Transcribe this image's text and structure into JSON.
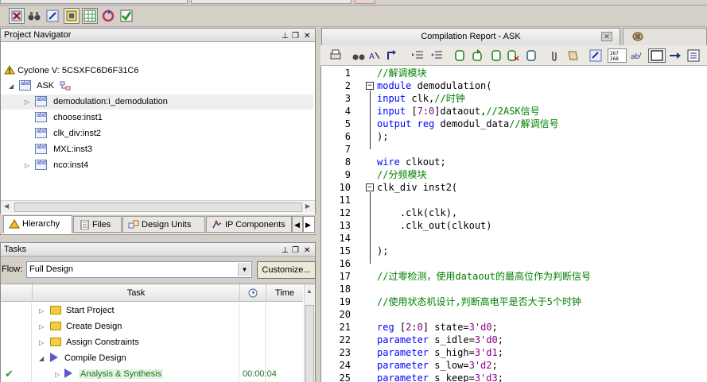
{
  "navigator": {
    "title": "Project Navigator",
    "device": "Cyclone V: 5CSXFC6D6F31C6",
    "top_entity": "ASK",
    "instances": [
      {
        "label": "demodulation:i_demodulation",
        "expandable": true,
        "selected": true
      },
      {
        "label": "choose:inst1",
        "expandable": false
      },
      {
        "label": "clk_div:inst2",
        "expandable": false
      },
      {
        "label": "MXL:inst3",
        "expandable": false
      },
      {
        "label": "nco:inst4",
        "expandable": true
      }
    ],
    "tabs": [
      "Hierarchy",
      "Files",
      "Design Units",
      "IP Components"
    ]
  },
  "tasks": {
    "title": "Tasks",
    "flow_label": "Flow:",
    "flow_value": "Full Design",
    "customize_label": "Customize...",
    "columns": [
      "Task",
      "Time"
    ],
    "rows": [
      {
        "status": "",
        "label": "Start Project",
        "icon": "folder-icon",
        "time": ""
      },
      {
        "status": "",
        "label": "Create Design",
        "icon": "folder-icon",
        "time": ""
      },
      {
        "status": "",
        "label": "Assign Constraints",
        "icon": "folder-icon",
        "time": ""
      },
      {
        "status": "",
        "label": "Compile Design",
        "icon": "play-icon",
        "time": ""
      },
      {
        "status": "✔",
        "label": "Analysis & Synthesis",
        "icon": "play-icon",
        "time": "00:00:04"
      }
    ]
  },
  "editor": {
    "tab_title": "Compilation Report - ASK",
    "lines": [
      {
        "n": "1",
        "code": "//解调模块",
        "fold": ""
      },
      {
        "n": "2",
        "code": "module demodulation(",
        "fold": "minus"
      },
      {
        "n": "3",
        "code": "input clk,//时钟",
        "fold": ""
      },
      {
        "n": "4",
        "code": "input [7:0]dataout,//2ASK信号",
        "fold": ""
      },
      {
        "n": "5",
        "code": "output reg demodul_data//解调信号",
        "fold": ""
      },
      {
        "n": "6",
        "code": ");",
        "fold": ""
      },
      {
        "n": "7",
        "code": "",
        "fold": ""
      },
      {
        "n": "8",
        "code": "wire clkout;",
        "fold": ""
      },
      {
        "n": "9",
        "code": "//分频模块",
        "fold": ""
      },
      {
        "n": "10",
        "code": "clk_div inst2(",
        "fold": "minus"
      },
      {
        "n": "11",
        "code": "",
        "fold": ""
      },
      {
        "n": "12",
        "code": "    .clk(clk),",
        "fold": ""
      },
      {
        "n": "13",
        "code": "    .clk_out(clkout)",
        "fold": ""
      },
      {
        "n": "14",
        "code": "",
        "fold": ""
      },
      {
        "n": "15",
        "code": ");",
        "fold": ""
      },
      {
        "n": "16",
        "code": "",
        "fold": ""
      },
      {
        "n": "17",
        "code": "//过零检测，使用dataout的最高位作为判断信号",
        "fold": ""
      },
      {
        "n": "18",
        "code": "",
        "fold": ""
      },
      {
        "n": "19",
        "code": "//使用状态机设计,判断高电平是否大于5个时钟",
        "fold": ""
      },
      {
        "n": "20",
        "code": "",
        "fold": ""
      },
      {
        "n": "21",
        "code": "reg [2:0] state=3'd0;",
        "fold": ""
      },
      {
        "n": "22",
        "code": "parameter s_idle=3'd0;",
        "fold": ""
      },
      {
        "n": "23",
        "code": "parameter s_high=3'd1;",
        "fold": ""
      },
      {
        "n": "24",
        "code": "parameter s_low=3'd2;",
        "fold": ""
      },
      {
        "n": "25",
        "code": "parameter s_keep=3'd3;",
        "fold": ""
      }
    ]
  },
  "colors": {
    "keyword": "#0000ff",
    "comment": "#008000",
    "number": "#8b008b"
  }
}
